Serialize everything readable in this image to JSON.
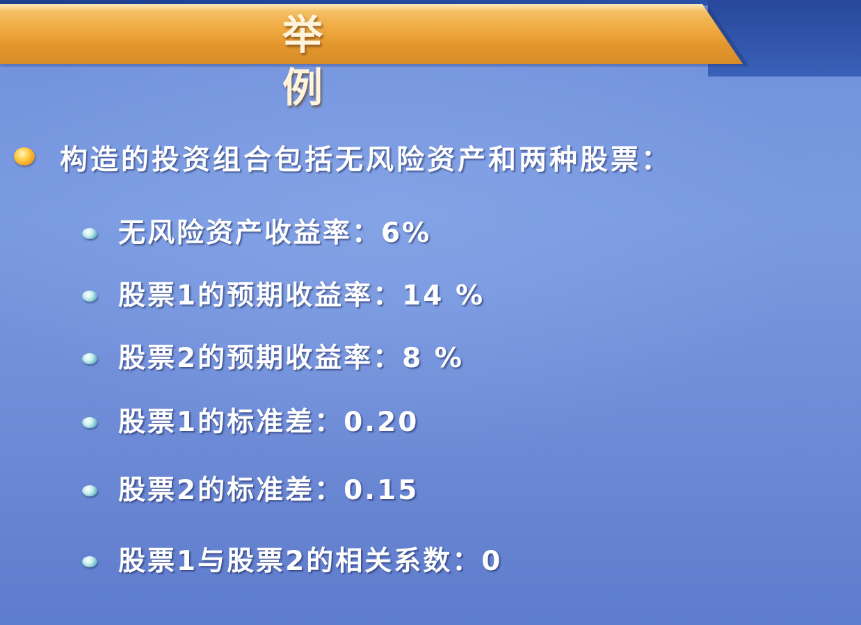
{
  "slide": {
    "title": "举  例",
    "main_bullet": "构造的投资组合包括无风险资产和两种股票：",
    "sub_bullets": [
      "无风险资产收益率：6%",
      "股票1的预期收益率：14 %",
      "股票2的预期收益率：8 %",
      "股票1的标准差：0.20",
      "股票2的标准差：0.15",
      "股票1与股票2的相关系数：0"
    ]
  },
  "colors": {
    "background": "#7a9ae0",
    "title_bar": "#f0ac44",
    "text": "#ffffff",
    "main_bullet_dot": "#f0981e",
    "sub_bullet_dot": "#5fb9c2"
  }
}
